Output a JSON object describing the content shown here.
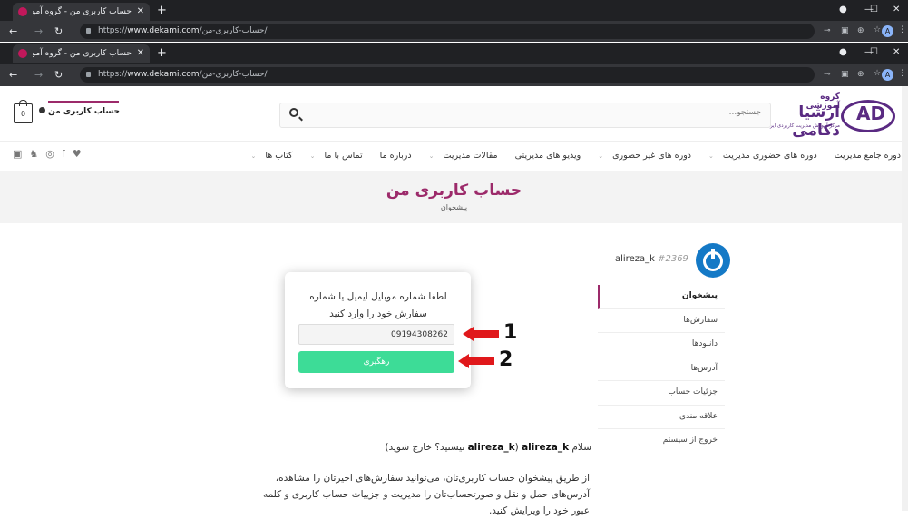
{
  "browser": {
    "tab_title": "حساب کاربری من - گروه آموزشی ار...",
    "tab_close": "✕",
    "new_tab": "+",
    "url_prefix": "https://",
    "url_domain": "www.dekami.com",
    "url_path": "/حساب-کاربری-من/",
    "avatar_letter": "A",
    "window_buttons": [
      "—",
      "☐",
      "✕"
    ]
  },
  "site": {
    "logo_small": "گروه آموزشی",
    "logo_big": "ارشیا دکامی",
    "logo_tagline": "مرکز آموزش مدیریت کاربردی ایران",
    "logo_mark": "AD",
    "search_placeholder": "جستجو...",
    "account_link": "حساب کاربری من",
    "cart_count": "0",
    "menu": [
      {
        "label": "دوره جامع مدیریت",
        "caret": ""
      },
      {
        "label": "دوره های حضوری مدیریت",
        "caret": "⌄"
      },
      {
        "label": "دوره های غیر حضوری",
        "caret": "⌄"
      },
      {
        "label": "ویدیو های مدیریتی",
        "caret": ""
      },
      {
        "label": "مقالات مدیریت",
        "caret": "⌄"
      },
      {
        "label": "درباره ما",
        "caret": ""
      },
      {
        "label": "تماس با ما",
        "caret": "⌄"
      },
      {
        "label": "کتاب ها",
        "caret": "⌄"
      }
    ],
    "social_icons": [
      "linkedin-icon",
      "twitter-icon",
      "instagram-icon",
      "facebook-icon",
      "heart-icon"
    ]
  },
  "banner": {
    "title": "حساب کاربری من",
    "subtitle": "پیشخوان"
  },
  "user": {
    "name": "alireza_k",
    "id": "#2369"
  },
  "sidebar": {
    "items": [
      {
        "label": "پیشخوان",
        "active": true
      },
      {
        "label": "سفارش‌ها",
        "active": false
      },
      {
        "label": "دانلودها",
        "active": false
      },
      {
        "label": "آدرس‌ها",
        "active": false
      },
      {
        "label": "جزئیات حساب",
        "active": false
      },
      {
        "label": "علاقه مندی",
        "active": false
      },
      {
        "label": "خروج از سیستم",
        "active": false
      }
    ]
  },
  "popup": {
    "prompt": "لطفا شماره موبایل ایمیل یا شماره سفارش خود را وارد کنید",
    "input_value": "09194308262",
    "button_label": "رهگیری",
    "annotations": [
      "1",
      "2"
    ]
  },
  "content": {
    "greeting_prefix": "سلام",
    "greeting_name": "alireza_k",
    "greeting_mid": "(",
    "greeting_name2": "alireza_k",
    "greeting_question": "نیستید؟",
    "logout_link": "خارج شوید",
    "greeting_end": ")",
    "paragraph": "از طریق پیشخوان حساب کاربری‌تان، می‌توانید سفارش‌های اخیرتان را مشاهده، آدرس‌های حمل و نقل و صورتحساب‌تان را مدیریت و جزییات حساب کاربری و کلمه عبور خود را ویرایش کنید."
  },
  "colors": {
    "brand": "#5a2a82",
    "accent": "#9c2a6a",
    "button": "#3ddc97",
    "user_icon": "#1479c6"
  }
}
